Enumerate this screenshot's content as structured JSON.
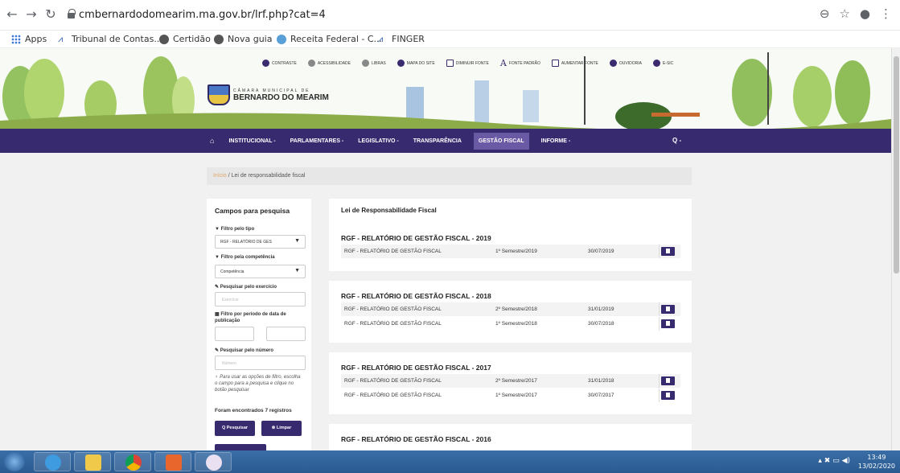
{
  "browser": {
    "url": "cmbernardodomearim.ma.gov.br/lrf.php?cat=4",
    "bookmarks": [
      {
        "label": "Apps",
        "icon": "apps-grid-icon"
      },
      {
        "label": "Tribunal de Contas...",
        "icon": "tribunal-logo-icon"
      },
      {
        "label": "Certidão",
        "icon": "globe-icon"
      },
      {
        "label": "Nova guia",
        "icon": "globe-icon"
      },
      {
        "label": "Receita Federal - C...",
        "icon": "receita-logo-icon"
      },
      {
        "label": "FINGER",
        "icon": "finger-logo-icon"
      }
    ]
  },
  "site": {
    "accessibility": [
      "CONTRASTE",
      "ACESSIBILIDADE",
      "LIBRAS",
      "MAPA DO SITE",
      "DIMINUIR FONTE",
      "FONTE PADRÃO",
      "AUMENTAR FONTE",
      "OUVIDORIA",
      "E-SIC"
    ],
    "logo_small": "CÂMARA MUNICIPAL DE",
    "logo_big": "BERNARDO DO MEARIM",
    "nav": [
      "INSTITUCIONAL -",
      "PARLAMENTARES -",
      "LEGISLATIVO -",
      "TRANSPARÊNCIA",
      "GESTÃO FISCAL",
      "INFORME -"
    ],
    "nav_search": "Q -",
    "breadcrumb_home": "Início",
    "breadcrumb_current": "/ Lei de responsabilidade fiscal"
  },
  "sidebar": {
    "title": "Campos para pesquisa",
    "filter_type_label": "▼ Filtro pelo tipo",
    "filter_type_value": "RGF - RELATÓRIO DE GES",
    "filter_comp_label": "▼ Filtro pela competência",
    "filter_comp_value": "Competência",
    "search_year_label": "✎ Pesquisar pelo exercício",
    "search_year_placeholder": "Exercício",
    "date_filter_label": "▦ Filtro por período de data de publicação",
    "search_number_label": "✎ Pesquisar pelo número",
    "search_number_placeholder": "Número",
    "note": "♀ Para usar as opções de filtro, escolha o campo para a pesquisa e clique no botão pesquisar",
    "count": "Foram encontrados 7 registros",
    "search_btn": "Q Pesquisar",
    "clear_btn": "⊗ Limpar"
  },
  "main": {
    "title": "Lei de Responsabilidade Fiscal",
    "sections": [
      {
        "title": "RGF - RELATÓRIO DE GESTÃO FISCAL - 2019",
        "rows": [
          {
            "name": "RGF - RELATÓRIO DE GESTÃO FISCAL",
            "period": "1º Semestre/2019",
            "date": "30/07/2019"
          }
        ]
      },
      {
        "title": "RGF - RELATÓRIO DE GESTÃO FISCAL - 2018",
        "rows": [
          {
            "name": "RGF - RELATÓRIO DE GESTÃO FISCAL",
            "period": "2º Semestre/2018",
            "date": "31/01/2019"
          },
          {
            "name": "RGF - RELATÓRIO DE GESTÃO FISCAL",
            "period": "1º Semestre/2018",
            "date": "30/07/2018"
          }
        ]
      },
      {
        "title": "RGF - RELATÓRIO DE GESTÃO FISCAL - 2017",
        "rows": [
          {
            "name": "RGF - RELATÓRIO DE GESTÃO FISCAL",
            "period": "2º Semestre/2017",
            "date": "31/01/2018"
          },
          {
            "name": "RGF - RELATÓRIO DE GESTÃO FISCAL",
            "period": "1º Semestre/2017",
            "date": "30/07/2017"
          }
        ]
      },
      {
        "title": "RGF - RELATÓRIO DE GESTÃO FISCAL - 2016",
        "rows": []
      }
    ]
  },
  "taskbar": {
    "time": "13:49",
    "date": "13/02/2020"
  },
  "colors": {
    "nav_bg": "#372a6f",
    "accent": "#6a5aa6"
  }
}
